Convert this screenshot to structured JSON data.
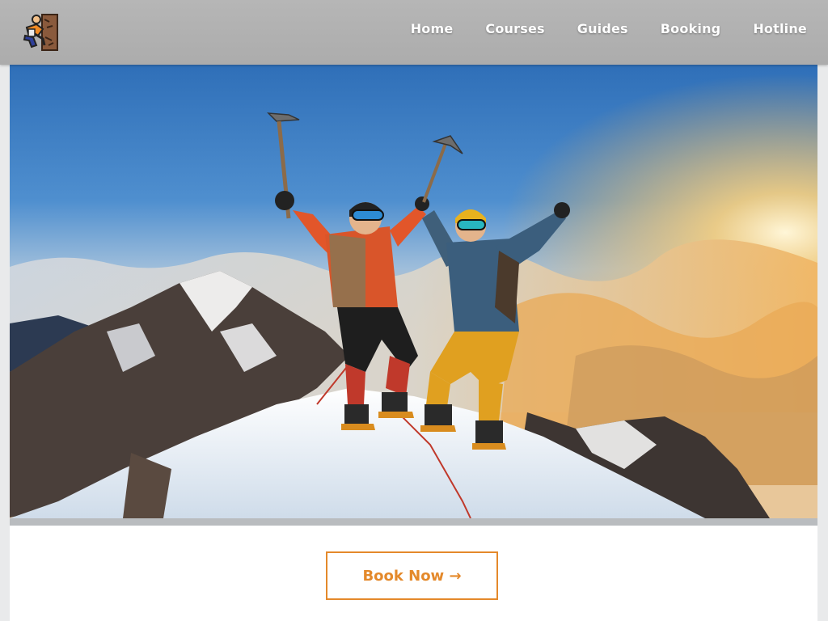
{
  "header": {
    "logo_icon": "climber-logo-icon",
    "nav": [
      "Home",
      "Courses",
      "Guides",
      "Booking",
      "Hotline"
    ]
  },
  "hero": {
    "image_subject": "climbers-on-summit-photo"
  },
  "cta": {
    "label": "Book Now →",
    "color": "#e4892b"
  }
}
